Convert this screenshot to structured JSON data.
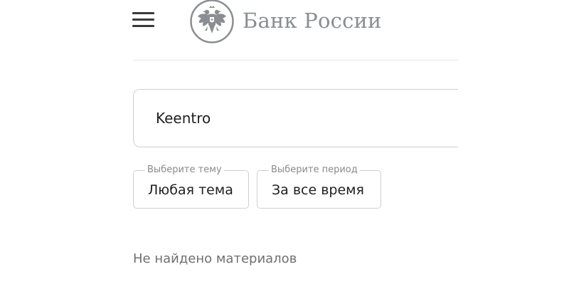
{
  "header": {
    "menu_icon": "hamburger-menu-icon",
    "logo_icon": "double-headed-eagle-emblem-icon",
    "logo_text": "Банк России",
    "logo_color": "#8a8d91"
  },
  "search": {
    "value": "Keentro"
  },
  "filters": {
    "theme": {
      "legend": "Выберите тему",
      "value": "Любая тема"
    },
    "period": {
      "legend": "Выберите период",
      "value": "За все время"
    }
  },
  "results": {
    "empty_message": "Не найдено материалов"
  }
}
